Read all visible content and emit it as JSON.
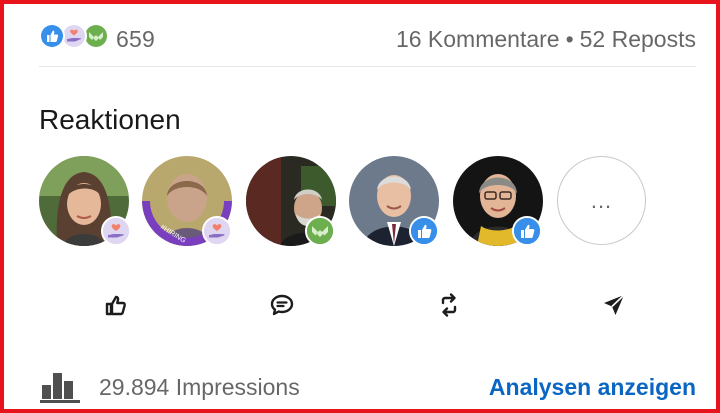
{
  "post_social": {
    "reaction_icons": [
      "like-reaction-icon",
      "love-reaction-icon",
      "support-reaction-icon"
    ],
    "reaction_count": "659",
    "comments": "16 Kommentare",
    "separator": "•",
    "reposts": "52 Reposts"
  },
  "reactions": {
    "title": "Reaktionen",
    "people": [
      {
        "avatar": "avatar-woman-long-hair",
        "reaction": "love"
      },
      {
        "avatar": "avatar-hiring-frame",
        "reaction": "love",
        "frame_text": "#HIRING"
      },
      {
        "avatar": "avatar-man-beard",
        "reaction": "support"
      },
      {
        "avatar": "avatar-man-suit",
        "reaction": "like"
      },
      {
        "avatar": "avatar-woman-glasses",
        "reaction": "like"
      }
    ],
    "more_label": "..."
  },
  "actions": {
    "items": [
      "like-icon",
      "comment-icon",
      "repost-icon",
      "send-icon"
    ]
  },
  "footer": {
    "impressions": "29.894 Impressions",
    "analytics_link": "Analysen anzeigen"
  },
  "colors": {
    "frame_red": "#e8141c",
    "link_blue": "#0a66c2",
    "like_blue": "#378fe9",
    "love_purple": "#b39fdb",
    "support_green": "#44712e"
  }
}
